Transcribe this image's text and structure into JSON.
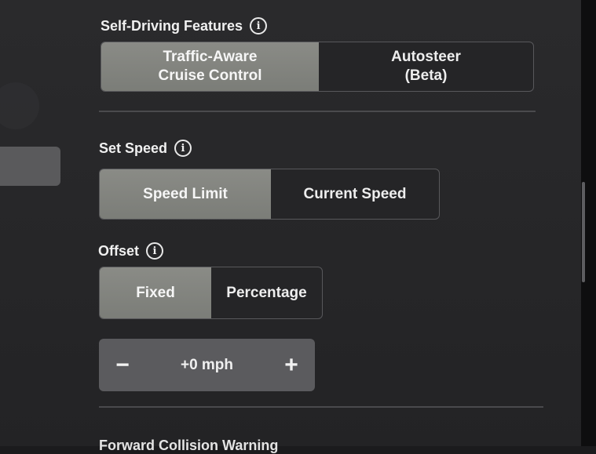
{
  "self_driving": {
    "heading": "Self-Driving Features",
    "options": [
      "Traffic-Aware\nCruise Control",
      "Autosteer\n(Beta)"
    ],
    "selected_index": 0
  },
  "set_speed": {
    "heading": "Set Speed",
    "options": [
      "Speed Limit",
      "Current Speed"
    ],
    "selected_index": 0
  },
  "offset": {
    "heading": "Offset",
    "options": [
      "Fixed",
      "Percentage"
    ],
    "selected_index": 0,
    "stepper": {
      "minus": "−",
      "value": "+0 mph",
      "plus": "+"
    }
  },
  "next_section": {
    "heading": "Forward Collision Warning"
  },
  "icons": {
    "info": "info-icon"
  }
}
